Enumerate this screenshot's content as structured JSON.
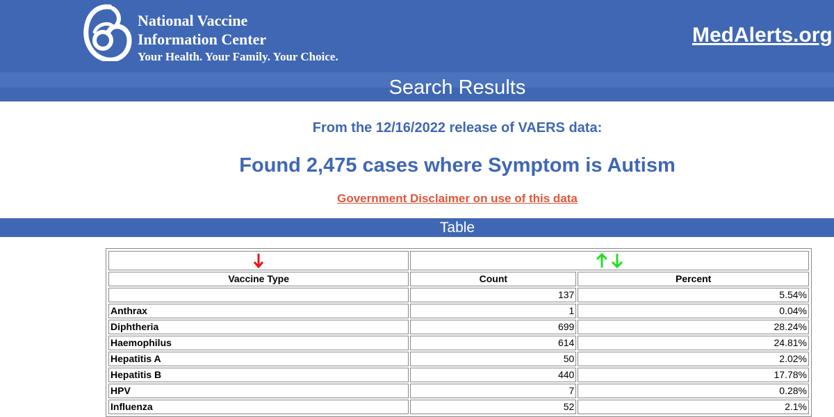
{
  "header": {
    "org_name_line1": "National Vaccine",
    "org_name_line2": "Information Center",
    "tagline": "Your Health. Your Family. Your Choice.",
    "site_link": "MedAlerts.org",
    "logo_icon": "mother-child-logo-icon"
  },
  "page_title": "Search Results",
  "release_text": "From the 12/16/2022 release of VAERS data:",
  "found_text": "Found 2,475 cases where Symptom is Autism",
  "disclaimer_link": "Government Disclaimer on use of this data",
  "table_band_title": "Table",
  "table": {
    "sort_icons": {
      "type": "sort-down-arrow-icon",
      "count_up": "sort-up-arrow-icon",
      "count_down": "sort-down-arrow-icon"
    },
    "headers": {
      "vaccine_type": "Vaccine Type",
      "count": "Count",
      "percent": "Percent"
    },
    "rows": [
      {
        "type": "",
        "count": "137",
        "percent": "5.54%"
      },
      {
        "type": "Anthrax",
        "count": "1",
        "percent": "0.04%"
      },
      {
        "type": "Diphtheria",
        "count": "699",
        "percent": "28.24%"
      },
      {
        "type": "Haemophilus",
        "count": "614",
        "percent": "24.81%"
      },
      {
        "type": "Hepatitis A",
        "count": "50",
        "percent": "2.02%"
      },
      {
        "type": "Hepatitis B",
        "count": "440",
        "percent": "17.78%"
      },
      {
        "type": "HPV",
        "count": "7",
        "percent": "0.28%"
      },
      {
        "type": "Influenza",
        "count": "52",
        "percent": "2.1%"
      }
    ]
  },
  "colors": {
    "brand_blue": "#3f67b4",
    "disclaimer_red": "#e2563a",
    "sort_red": "#e8141c",
    "sort_green": "#22e022"
  }
}
